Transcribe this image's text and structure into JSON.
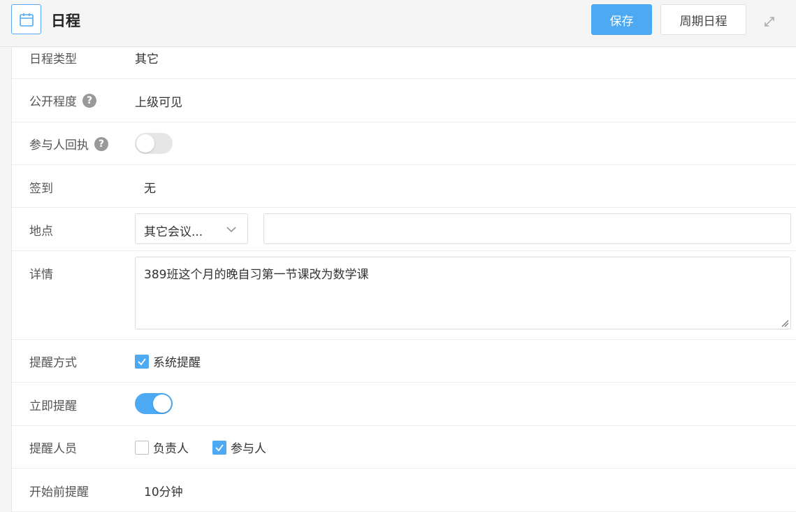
{
  "header": {
    "calendar_icon": "calendar-icon",
    "title": "日程",
    "save_label": "保存",
    "cycle_label": "周期日程",
    "expand_icon": "expand-icon",
    "accent": "#4ea9f3"
  },
  "form": {
    "type": {
      "label": "日程类型",
      "value": "其它"
    },
    "visibility": {
      "label": "公开程度",
      "help": "?",
      "value": "上级可见"
    },
    "receipt": {
      "label": "参与人回执",
      "help": "?",
      "enabled": false
    },
    "signin": {
      "label": "签到",
      "value": "无"
    },
    "location": {
      "label": "地点",
      "select_value": "其它会议...",
      "input_value": ""
    },
    "detail": {
      "label": "详情",
      "value": "389班这个月的晚自习第一节课改为数学课"
    },
    "remind_method": {
      "label": "提醒方式",
      "option": "系统提醒",
      "checked": true
    },
    "remind_now": {
      "label": "立即提醒",
      "enabled": true
    },
    "remind_people": {
      "label": "提醒人员",
      "options": [
        {
          "label": "负责人",
          "checked": false
        },
        {
          "label": "参与人",
          "checked": true
        }
      ]
    },
    "before_start": {
      "label": "开始前提醒",
      "value": "10分钟"
    }
  }
}
